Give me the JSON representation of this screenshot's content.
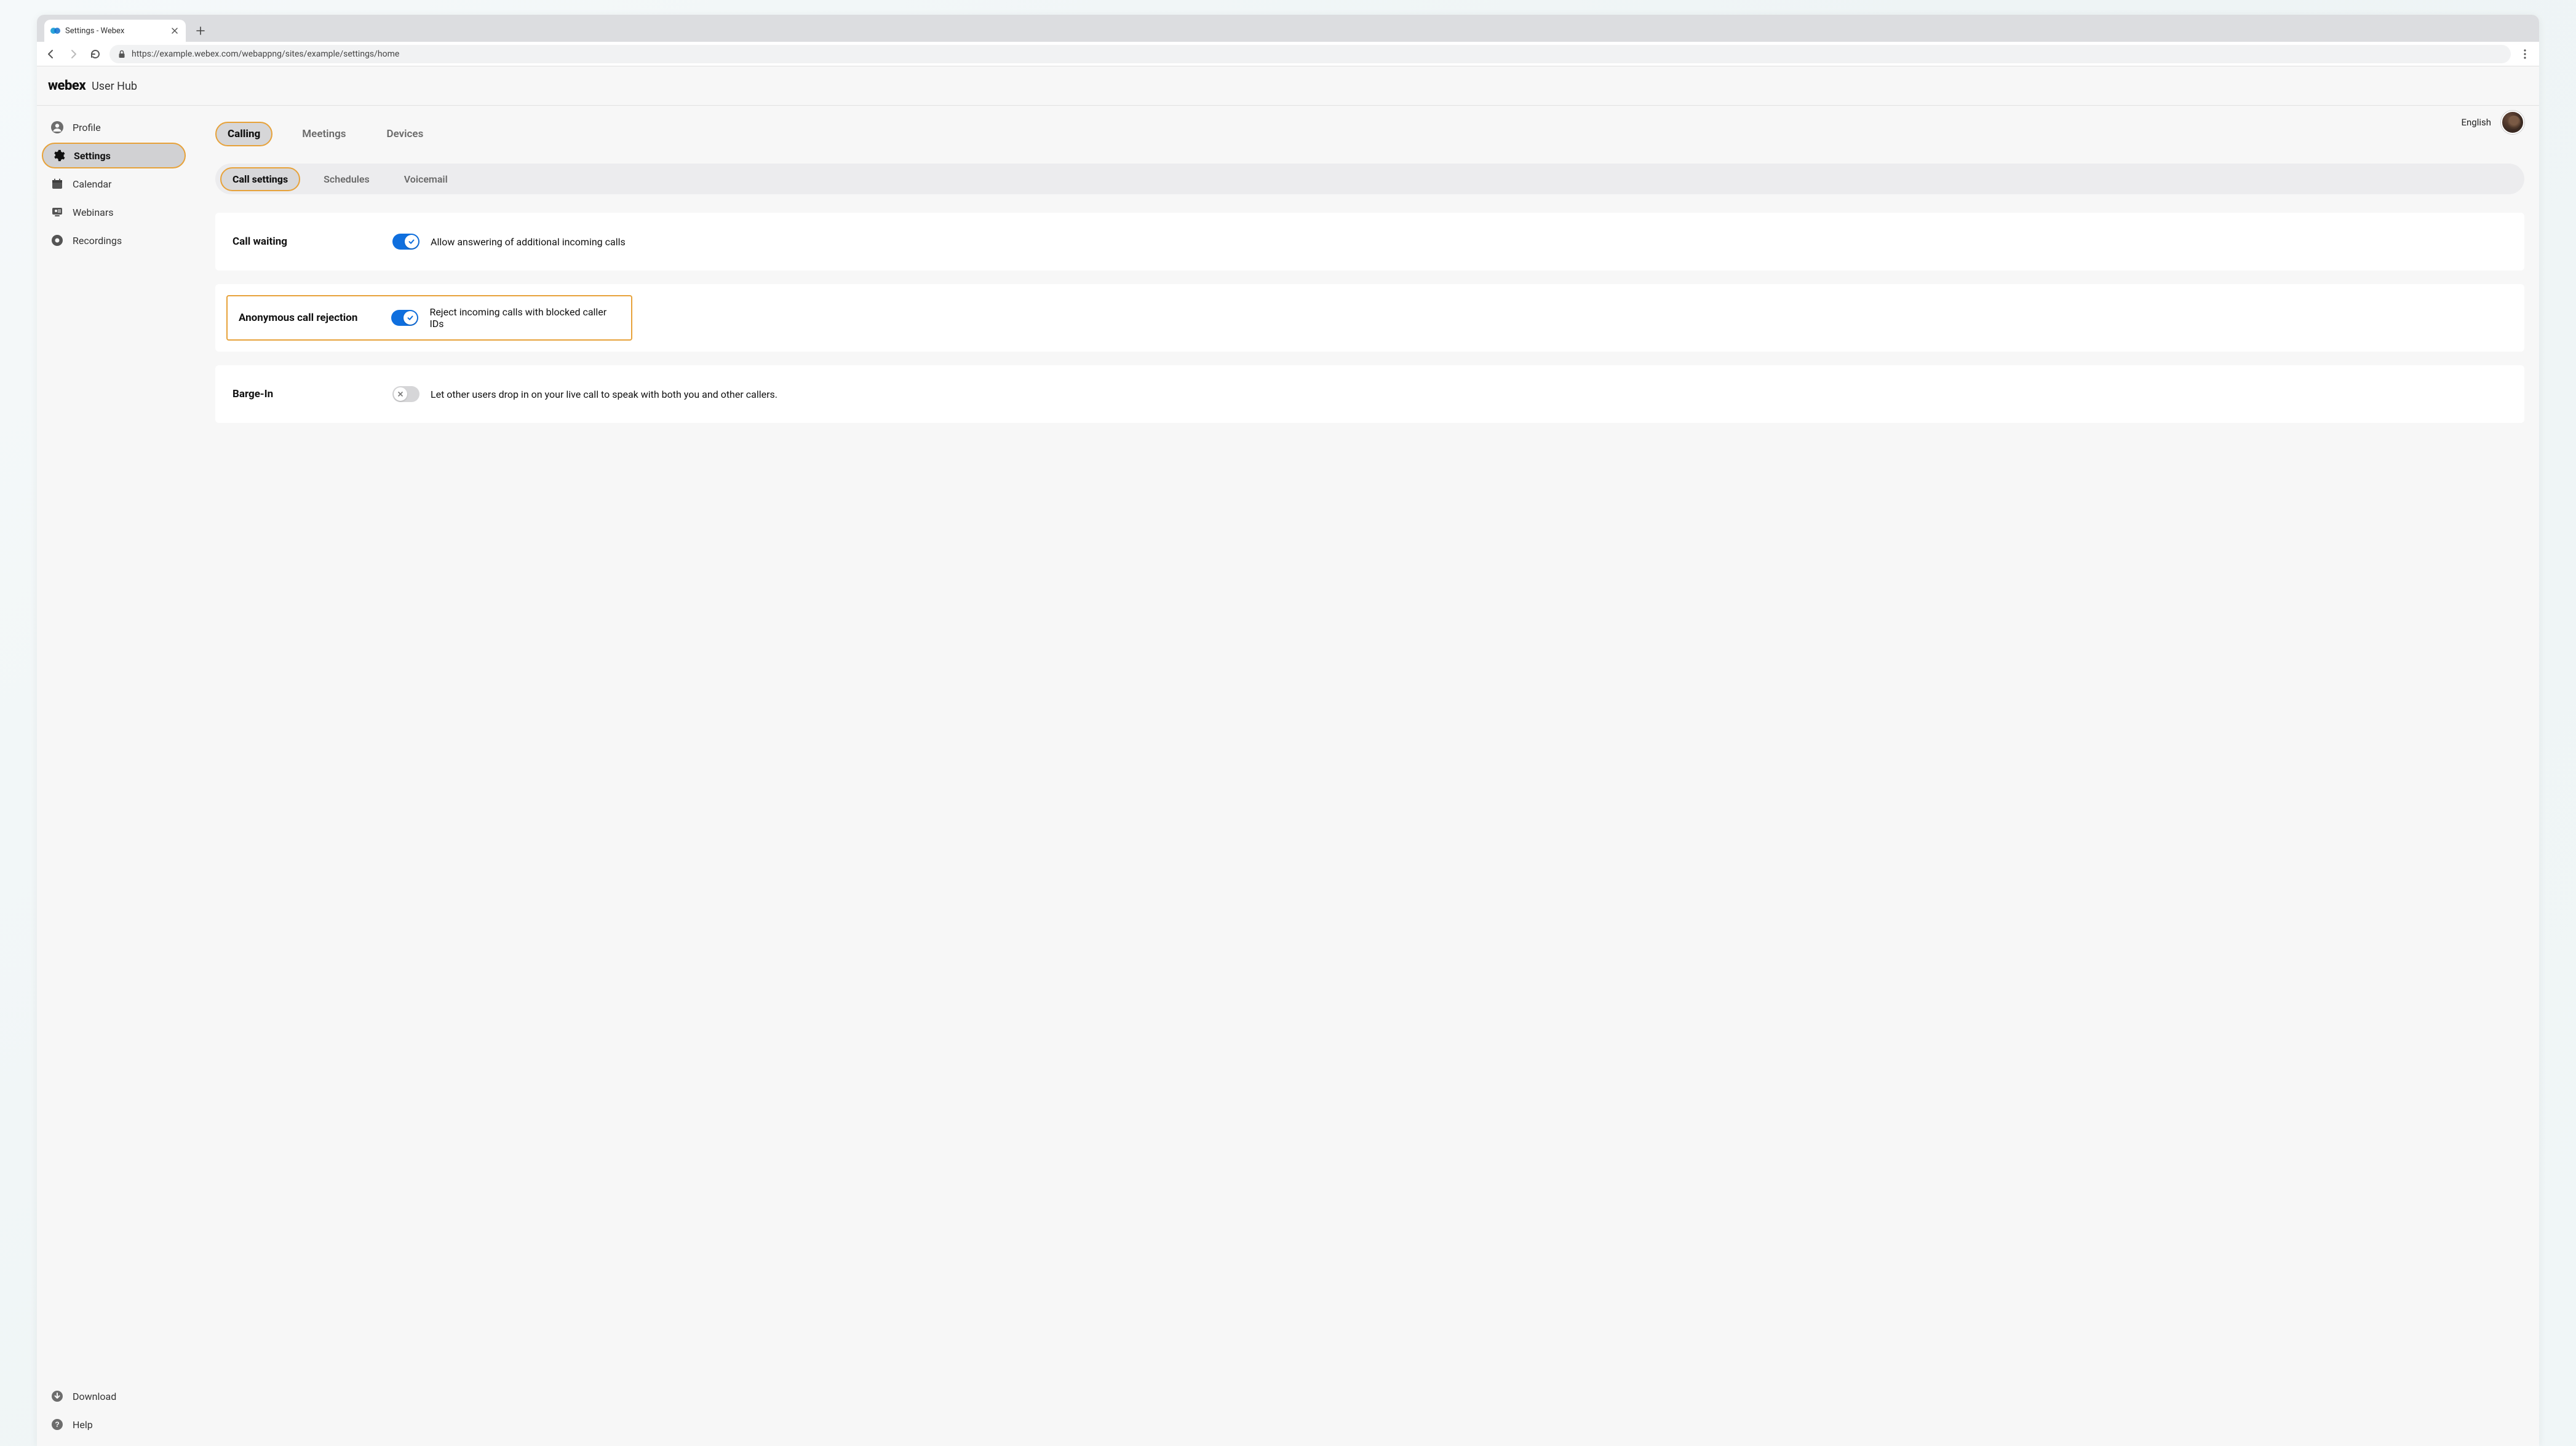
{
  "browser": {
    "tab_title": "Settings - Webex",
    "url": "https://example.webex.com/webappng/sites/example/settings/home"
  },
  "header": {
    "brand_logo": "webex",
    "brand_sub": "User Hub"
  },
  "topright": {
    "language": "English"
  },
  "sidebar": {
    "items": [
      {
        "label": "Profile",
        "icon": "person-icon"
      },
      {
        "label": "Settings",
        "icon": "gear-icon",
        "active": true
      },
      {
        "label": "Calendar",
        "icon": "calendar-icon"
      },
      {
        "label": "Webinars",
        "icon": "webinar-icon"
      },
      {
        "label": "Recordings",
        "icon": "record-icon"
      }
    ],
    "bottom": [
      {
        "label": "Download",
        "icon": "download-icon"
      },
      {
        "label": "Help",
        "icon": "help-icon"
      }
    ]
  },
  "primary_tabs": {
    "items": [
      {
        "label": "Calling",
        "active": true
      },
      {
        "label": "Meetings"
      },
      {
        "label": "Devices"
      }
    ]
  },
  "sub_tabs": {
    "items": [
      {
        "label": "Call settings",
        "active": true
      },
      {
        "label": "Schedules"
      },
      {
        "label": "Voicemail"
      }
    ]
  },
  "settings": {
    "call_waiting": {
      "title": "Call waiting",
      "toggle_on": true,
      "desc": "Allow answering of additional incoming calls"
    },
    "anon_reject": {
      "title": "Anonymous call rejection",
      "toggle_on": true,
      "desc": "Reject incoming calls with blocked caller IDs"
    },
    "barge_in": {
      "title": "Barge-In",
      "toggle_on": false,
      "desc": "Let other users drop in on your live call to speak with both you and other callers."
    }
  }
}
